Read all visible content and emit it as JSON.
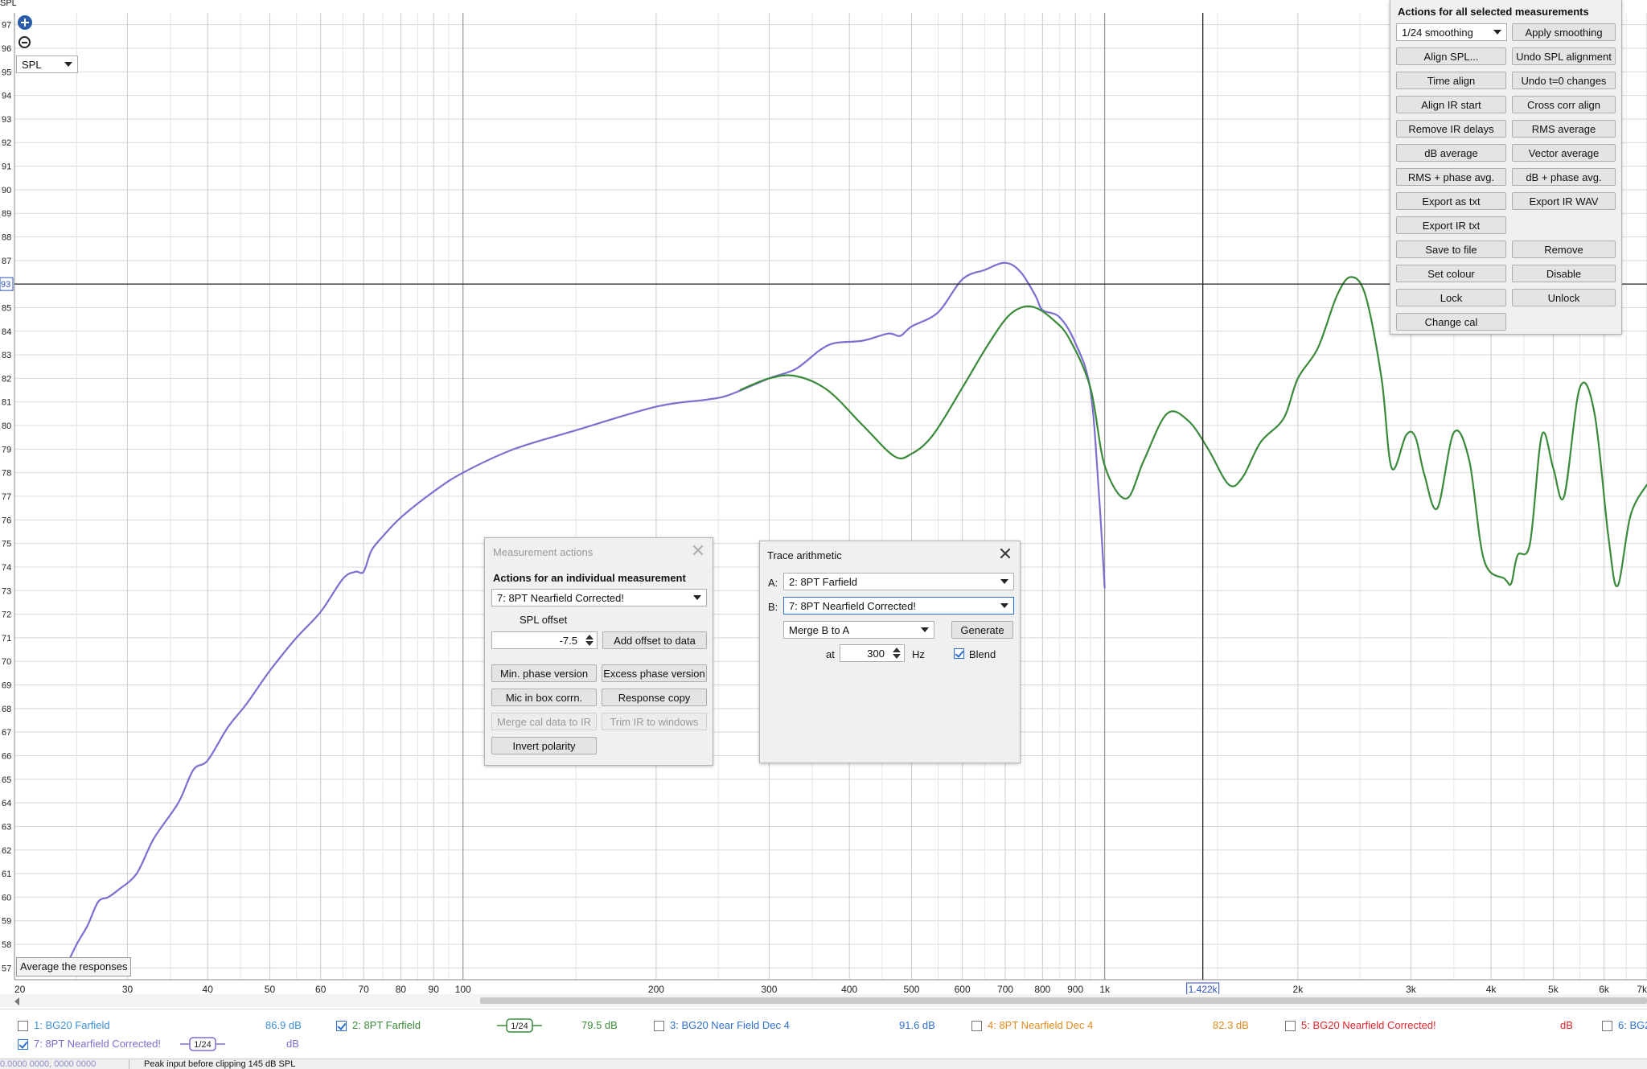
{
  "chart_data": {
    "type": "line",
    "ylabel": "SPL",
    "x_scale": "log",
    "xlim": [
      20,
      7000
    ],
    "ylim": [
      56.5,
      97.5
    ],
    "y_ticks": [
      57,
      58,
      59,
      60,
      61,
      62,
      63,
      64,
      65,
      66,
      67,
      68,
      69,
      70,
      71,
      72,
      73,
      74,
      75,
      76,
      77,
      78,
      79,
      80,
      81,
      82,
      83,
      84,
      85,
      86,
      87,
      88,
      89,
      90,
      91,
      92,
      93,
      94,
      95,
      96,
      97
    ],
    "x_ticks": [
      {
        "v": 20,
        "label": "20"
      },
      {
        "v": 30,
        "label": "30"
      },
      {
        "v": 40,
        "label": "40"
      },
      {
        "v": 50,
        "label": "50"
      },
      {
        "v": 60,
        "label": "60"
      },
      {
        "v": 70,
        "label": "70"
      },
      {
        "v": 80,
        "label": "80"
      },
      {
        "v": 90,
        "label": "90"
      },
      {
        "v": 100,
        "label": "100"
      },
      {
        "v": 200,
        "label": "200"
      },
      {
        "v": 300,
        "label": "300"
      },
      {
        "v": 400,
        "label": "400"
      },
      {
        "v": 500,
        "label": "500"
      },
      {
        "v": 600,
        "label": "600"
      },
      {
        "v": 700,
        "label": "700"
      },
      {
        "v": 800,
        "label": "800"
      },
      {
        "v": 900,
        "label": "900"
      },
      {
        "v": 1000,
        "label": "1k"
      },
      {
        "v": 2000,
        "label": "2k"
      },
      {
        "v": 3000,
        "label": "3k"
      },
      {
        "v": 4000,
        "label": "4k"
      },
      {
        "v": 5000,
        "label": "5k"
      },
      {
        "v": 6000,
        "label": "6k"
      },
      {
        "v": 7000,
        "label": "7k"
      }
    ],
    "cursor": {
      "x": 1422,
      "x_label": "1.422k",
      "y": 86,
      "y_label": "93"
    },
    "series": [
      {
        "name": "7: 8PT Nearfield Corrected!",
        "color": "#7b6fd0",
        "points": [
          [
            24,
            57
          ],
          [
            25,
            58
          ],
          [
            26,
            58.8
          ],
          [
            27,
            59.8
          ],
          [
            28,
            60
          ],
          [
            29,
            60.3
          ],
          [
            31,
            61
          ],
          [
            33,
            62.5
          ],
          [
            36,
            64
          ],
          [
            38,
            65.4
          ],
          [
            40,
            65.8
          ],
          [
            43,
            67.2
          ],
          [
            46,
            68.2
          ],
          [
            50,
            69.6
          ],
          [
            55,
            71
          ],
          [
            60,
            72.1
          ],
          [
            65,
            73.5
          ],
          [
            68,
            73.8
          ],
          [
            70,
            73.8
          ],
          [
            72,
            74.7
          ],
          [
            75,
            75.3
          ],
          [
            80,
            76.1
          ],
          [
            90,
            77.2
          ],
          [
            100,
            78
          ],
          [
            120,
            79
          ],
          [
            150,
            79.8
          ],
          [
            200,
            80.8
          ],
          [
            240,
            81.1
          ],
          [
            260,
            81.3
          ],
          [
            300,
            82
          ],
          [
            330,
            82.4
          ],
          [
            360,
            83.2
          ],
          [
            380,
            83.5
          ],
          [
            420,
            83.6
          ],
          [
            460,
            83.9
          ],
          [
            480,
            83.8
          ],
          [
            500,
            84.2
          ],
          [
            550,
            84.8
          ],
          [
            600,
            86.2
          ],
          [
            650,
            86.6
          ],
          [
            700,
            86.9
          ],
          [
            740,
            86.5
          ],
          [
            780,
            85.5
          ],
          [
            800,
            84.9
          ],
          [
            850,
            84.6
          ],
          [
            900,
            83.5
          ],
          [
            950,
            81.5
          ],
          [
            980,
            77
          ],
          [
            1000,
            73.1
          ]
        ]
      },
      {
        "name": "2: 8PT Farfield",
        "color": "#3a8a3a",
        "points": [
          [
            270,
            81.5
          ],
          [
            300,
            82
          ],
          [
            330,
            82.1
          ],
          [
            370,
            81.5
          ],
          [
            420,
            80
          ],
          [
            470,
            78.7
          ],
          [
            500,
            78.8
          ],
          [
            540,
            79.6
          ],
          [
            600,
            81.6
          ],
          [
            650,
            83.2
          ],
          [
            700,
            84.5
          ],
          [
            740,
            85
          ],
          [
            780,
            85
          ],
          [
            830,
            84.5
          ],
          [
            880,
            83.7
          ],
          [
            950,
            81.6
          ],
          [
            1000,
            78.3
          ],
          [
            1080,
            76.9
          ],
          [
            1150,
            78.5
          ],
          [
            1250,
            80.5
          ],
          [
            1350,
            80.2
          ],
          [
            1450,
            79
          ],
          [
            1560,
            77.5
          ],
          [
            1640,
            77.8
          ],
          [
            1750,
            79.3
          ],
          [
            1900,
            80.3
          ],
          [
            2000,
            82
          ],
          [
            2150,
            83.3
          ],
          [
            2300,
            85.5
          ],
          [
            2420,
            86.3
          ],
          [
            2550,
            85.5
          ],
          [
            2700,
            82
          ],
          [
            2800,
            78.2
          ],
          [
            2950,
            79.6
          ],
          [
            3050,
            79.5
          ],
          [
            3150,
            77.9
          ],
          [
            3300,
            76.5
          ],
          [
            3500,
            79.7
          ],
          [
            3700,
            78.5
          ],
          [
            3900,
            74.3
          ],
          [
            4200,
            73.5
          ],
          [
            4300,
            73.3
          ],
          [
            4400,
            74.5
          ],
          [
            4600,
            75
          ],
          [
            4800,
            79.6
          ],
          [
            5000,
            78.2
          ],
          [
            5200,
            77
          ],
          [
            5500,
            81.6
          ],
          [
            5800,
            80.5
          ],
          [
            6100,
            75.2
          ],
          [
            6300,
            73.2
          ],
          [
            6600,
            76.2
          ],
          [
            7000,
            77.5
          ]
        ]
      }
    ]
  },
  "graph_controls": {
    "ylabel_corner": "SPL",
    "zoom_in_icon": "zoom-in-icon",
    "zoom_out_icon": "zoom-out-icon",
    "mode_select": "SPL",
    "average_tooltip": "Average the responses"
  },
  "all_actions": {
    "title": "Actions for all selected measurements",
    "smoothing_select": "1/24 smoothing",
    "buttons": [
      [
        "Apply smoothing"
      ],
      [
        "Align SPL...",
        "Undo SPL alignment"
      ],
      [
        "Time align",
        "Undo t=0 changes"
      ],
      [
        "Align IR start",
        "Cross corr align"
      ],
      [
        "Remove IR delays",
        "RMS average"
      ],
      [
        "dB average",
        "Vector average"
      ],
      [
        "RMS + phase avg.",
        "dB + phase avg."
      ],
      [
        "Export as txt",
        "Export IR WAV"
      ],
      [
        "Export IR txt"
      ],
      [
        "Save to file",
        "Remove"
      ],
      [
        "Set colour",
        "Disable"
      ],
      [
        "Lock",
        "Unlock"
      ],
      [
        "Change cal"
      ]
    ]
  },
  "measurement_actions": {
    "title": "Measurement actions",
    "subtitle": "Actions for an individual measurement",
    "measurement_select": "7: 8PT Nearfield Corrected!",
    "spl_offset_label": "SPL offset",
    "spl_offset_value": "-7.5",
    "add_offset": "Add offset to data",
    "min_phase": "Min. phase version",
    "excess_phase": "Excess phase version",
    "mic_in_box": "Mic in box corrn.",
    "response_copy": "Response copy",
    "merge_cal": "Merge cal data to IR",
    "trim_ir": "Trim IR to windows",
    "invert_polarity": "Invert polarity"
  },
  "trace_arithmetic": {
    "title": "Trace arithmetic",
    "a_label": "A:",
    "a_value": "2: 8PT Farfield",
    "b_label": "B:",
    "b_value": "7: 8PT Nearfield Corrected!",
    "operation": "Merge B to A",
    "generate": "Generate",
    "at_label": "at",
    "at_value": "300",
    "hz_label": "Hz",
    "blend_label": "Blend",
    "blend_checked": true
  },
  "legend": {
    "row1": [
      {
        "name": "1: BG20 Farfield",
        "value": "86.9 dB",
        "color": "#3b8fd6",
        "checked": false
      },
      {
        "name": "2: 8PT Farfield",
        "value": "79.5 dB",
        "color": "#3a8a3a",
        "checked": true,
        "badge": "1/24"
      },
      {
        "name": "3: BG20 Near Field Dec 4",
        "value": "91.6 dB",
        "color": "#2f6fcf",
        "checked": false
      },
      {
        "name": "4: 8PT Nearfield Dec 4",
        "value": "82.3 dB",
        "color": "#e08a1e",
        "checked": false
      },
      {
        "name": "5: BG20 Nearfield Corrected!",
        "value": "dB",
        "color": "#e0252b",
        "checked": false
      },
      {
        "name": "6: BG2",
        "value": "",
        "color": "#2f6fcf",
        "checked": false
      }
    ],
    "row2": [
      {
        "name": "7: 8PT Nearfield Corrected!",
        "value": "dB",
        "color": "#7b6fd0",
        "checked": true,
        "badge": "1/24"
      }
    ]
  },
  "status": {
    "left": "0.0000 0000, 0000 0000",
    "right": "Peak input before clipping 145 dB SPL"
  }
}
